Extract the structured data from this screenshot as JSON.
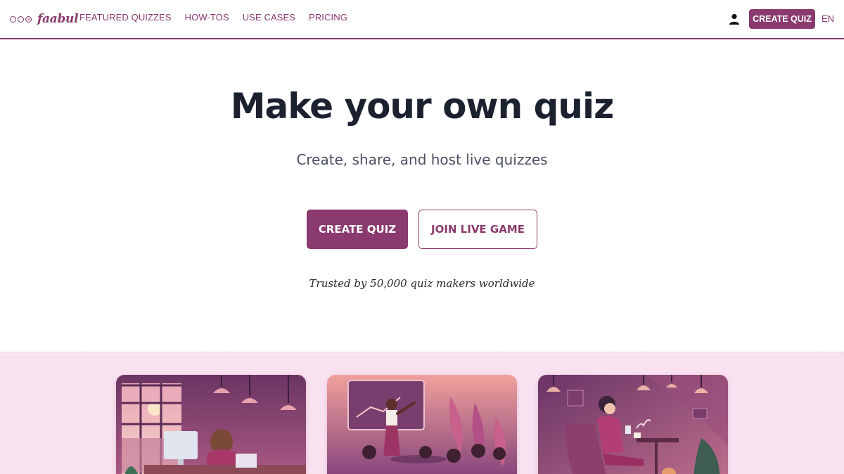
{
  "header": {
    "logo_text": "faabul",
    "nav": [
      "FEATURED QUIZZES",
      "HOW-TOS",
      "USE CASES",
      "PRICING"
    ],
    "user_icon": "user-icon",
    "create_label": "CREATE QUIZ",
    "language": "EN"
  },
  "hero": {
    "title": "Make your own quiz",
    "subtitle": "Create, share, and host live quizzes",
    "primary_button": "CREATE QUIZ",
    "secondary_button": "JOIN LIVE GAME",
    "trusted_text": "Trusted by 50,000 quiz makers worldwide"
  },
  "colors": {
    "brand": "#8a3a6e",
    "band_background": "#f9e1ef",
    "title_text": "#1c2130"
  }
}
